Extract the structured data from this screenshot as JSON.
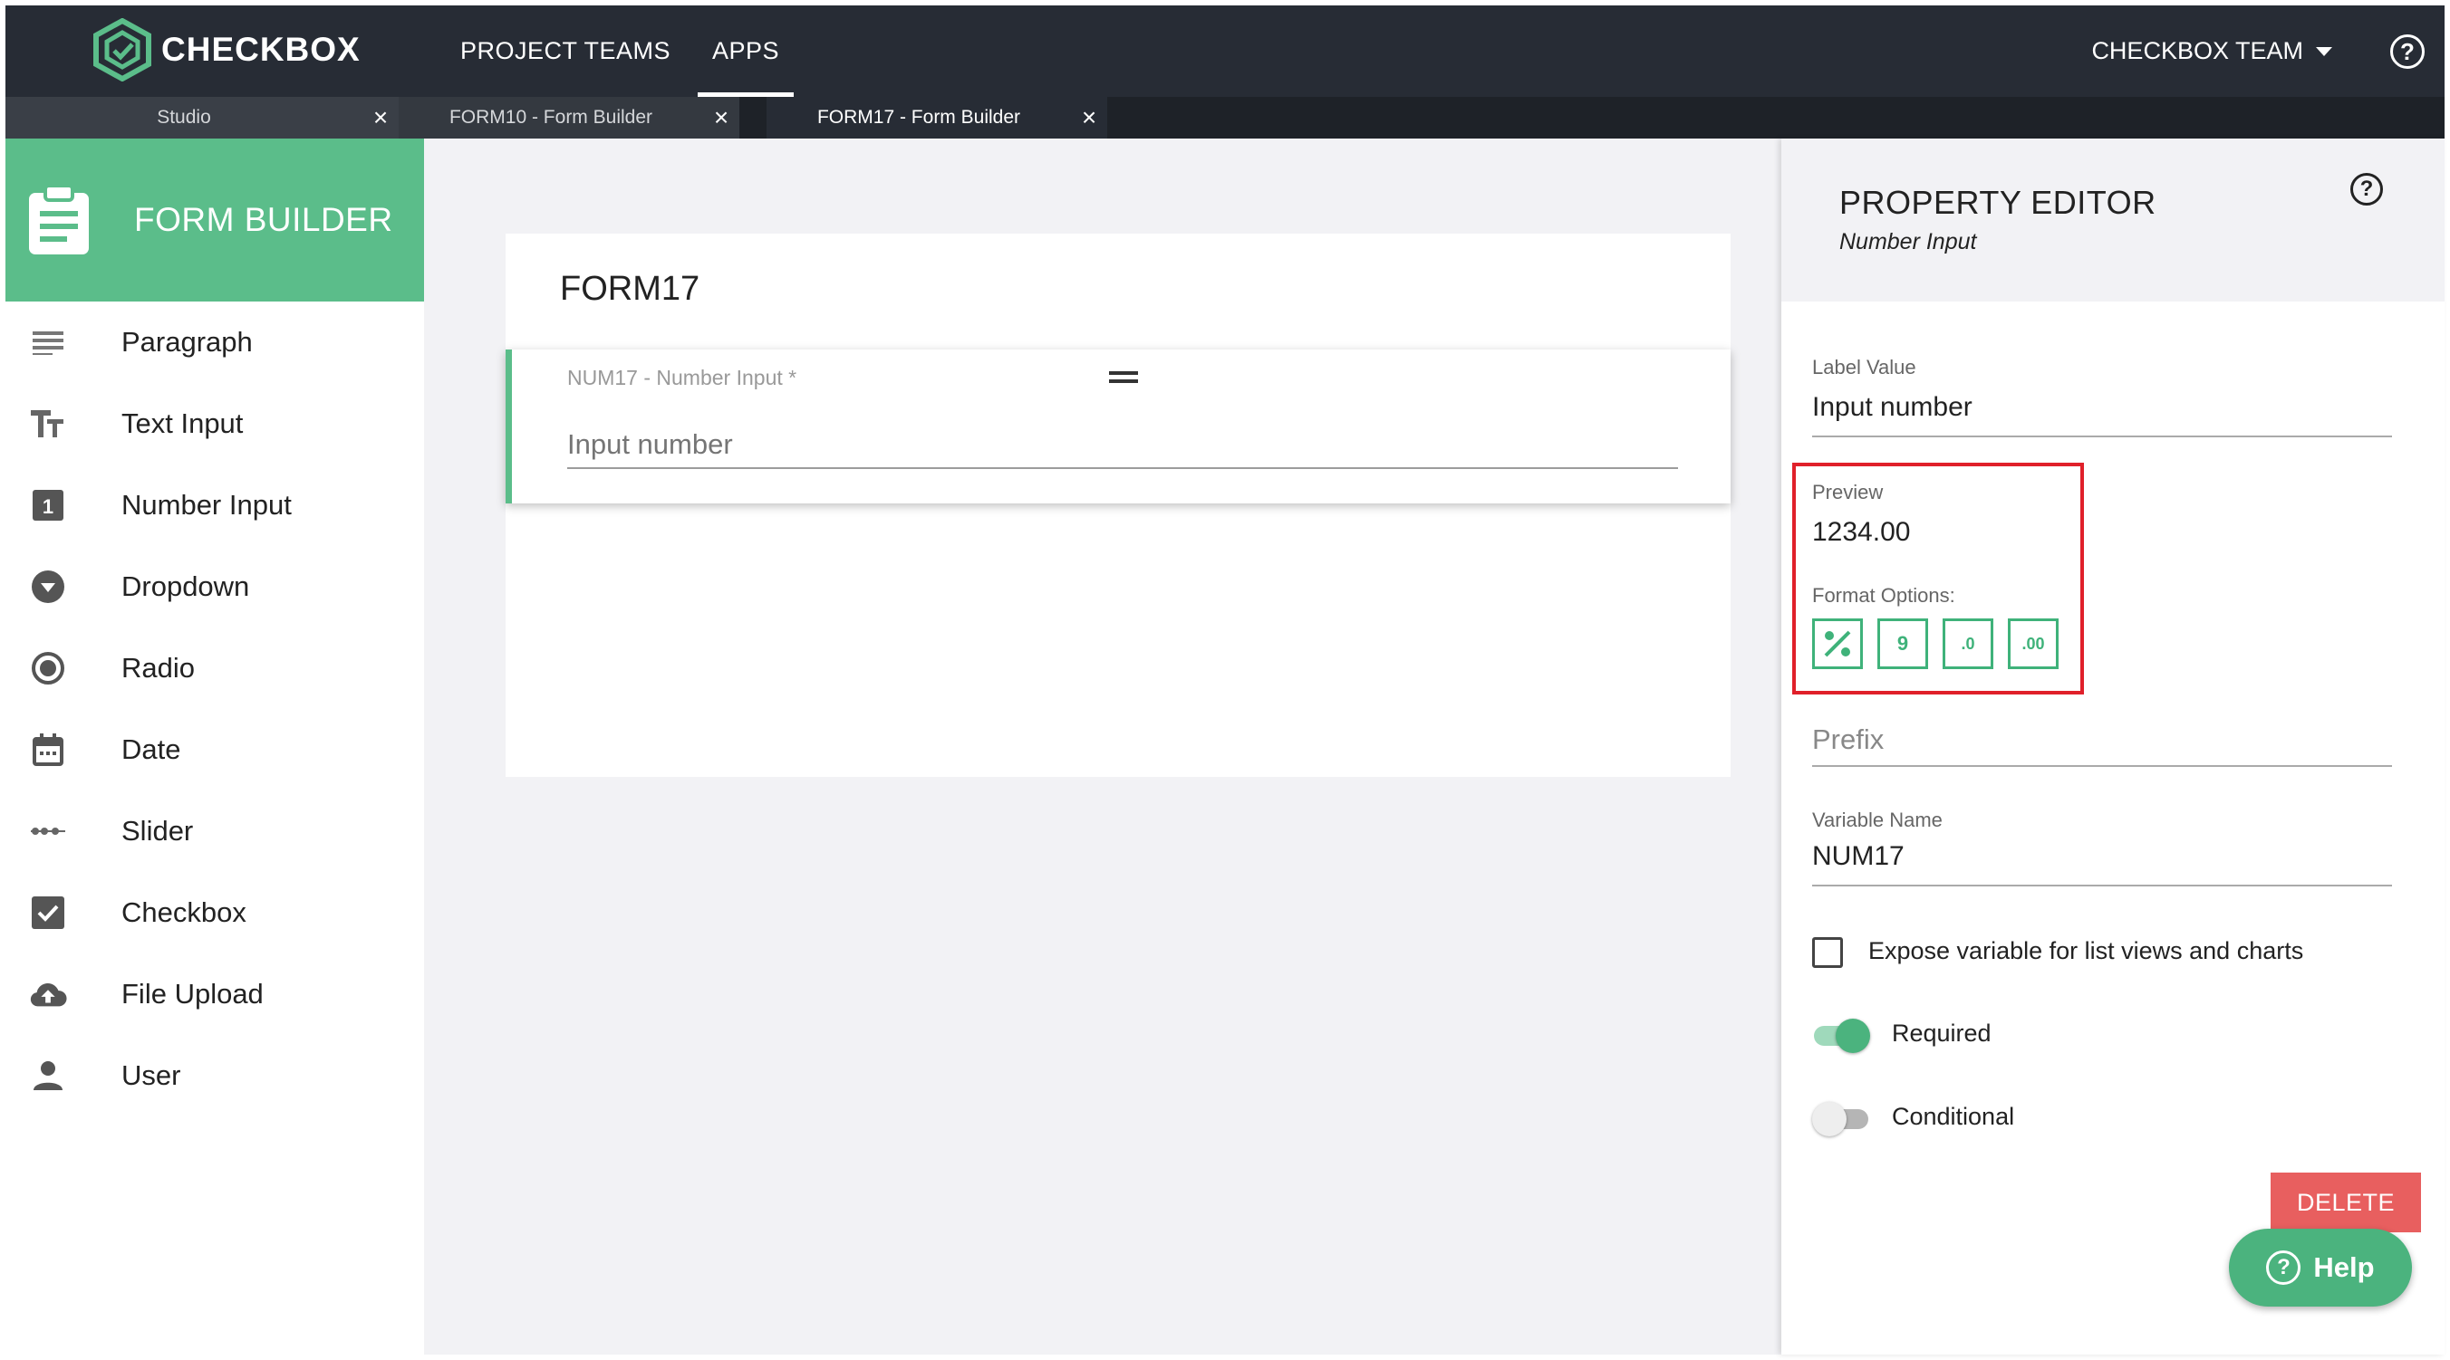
{
  "app": {
    "brand": "CHECKBOX",
    "nav": [
      "PROJECT TEAMS",
      "APPS"
    ],
    "active_nav": "APPS",
    "team": "CHECKBOX TEAM",
    "help_glyph": "?"
  },
  "tabs": [
    {
      "label": "Studio",
      "close": "×"
    },
    {
      "label": "FORM10 - Form Builder",
      "close": "×"
    },
    {
      "label": "FORM17 - Form Builder",
      "close": "×"
    }
  ],
  "sidebar": {
    "title": "FORM BUILDER",
    "items": [
      {
        "label": "Paragraph",
        "icon": "paragraph-icon"
      },
      {
        "label": "Text Input",
        "icon": "text-input-icon"
      },
      {
        "label": "Number Input",
        "icon": "number-input-icon"
      },
      {
        "label": "Dropdown",
        "icon": "dropdown-icon"
      },
      {
        "label": "Radio",
        "icon": "radio-icon"
      },
      {
        "label": "Date",
        "icon": "calendar-icon"
      },
      {
        "label": "Slider",
        "icon": "slider-icon"
      },
      {
        "label": "Checkbox",
        "icon": "checkbox-icon"
      },
      {
        "label": "File Upload",
        "icon": "cloud-upload-icon"
      },
      {
        "label": "User",
        "icon": "user-icon"
      }
    ]
  },
  "form": {
    "title": "FORM17",
    "field": {
      "label": "NUM17 - Number Input *",
      "placeholder": "Input number"
    }
  },
  "property_editor": {
    "title": "PROPERTY EDITOR",
    "subtitle": "Number Input",
    "label_value": {
      "label": "Label Value",
      "value": "Input number"
    },
    "preview": {
      "label": "Preview",
      "value": "1234.00"
    },
    "format_options": {
      "label": "Format Options:",
      "buttons": [
        {
          "name": "percent-format-icon",
          "glyph": "%"
        },
        {
          "name": "digit-format-icon",
          "glyph": "9"
        },
        {
          "name": "decrease-decimals-icon",
          "glyph": ".0"
        },
        {
          "name": "increase-decimals-icon",
          "glyph": ".00"
        }
      ]
    },
    "prefix": {
      "placeholder": "Prefix"
    },
    "variable_name": {
      "label": "Variable Name",
      "value": "NUM17"
    },
    "expose_checkbox": {
      "label": "Expose variable for list views and charts",
      "checked": false
    },
    "required_toggle": {
      "label": "Required",
      "on": true
    },
    "conditional_toggle": {
      "label": "Conditional",
      "on": false
    },
    "delete_label": "DELETE",
    "help_label": "Help"
  },
  "colors": {
    "accent": "#5bbd8a",
    "topbar": "#272c35",
    "delete": "#e85f5f",
    "highlight": "#e0202a"
  }
}
